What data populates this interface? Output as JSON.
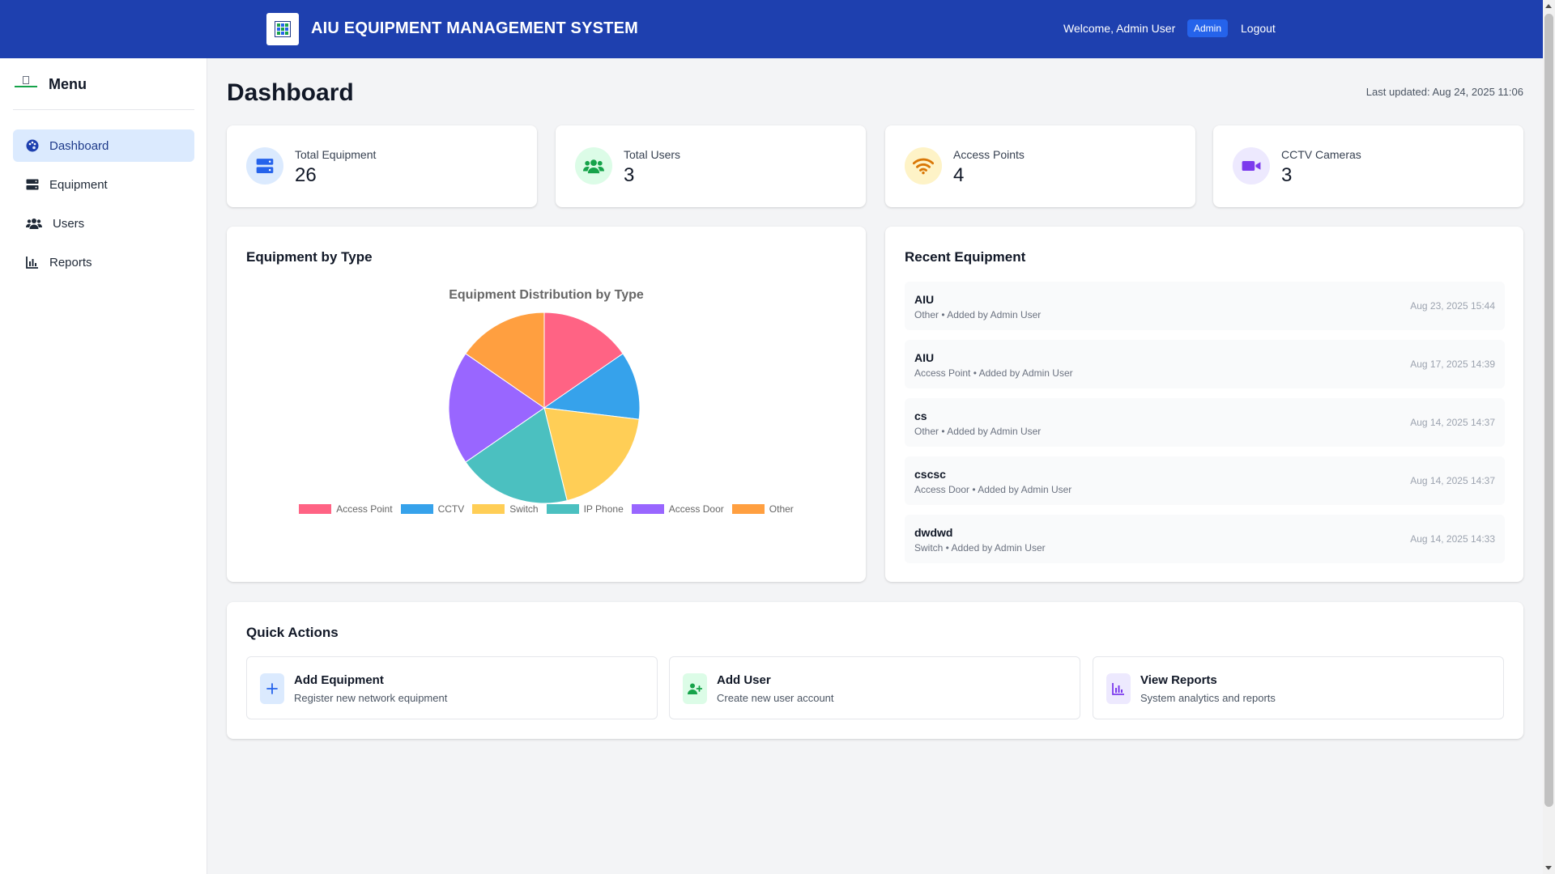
{
  "header": {
    "app_title": "AIU EQUIPMENT MANAGEMENT SYSTEM",
    "welcome": "Welcome, Admin User",
    "role_badge": "Admin",
    "logout": "Logout",
    "bg_color": "#1e40af"
  },
  "sidebar": {
    "title": "Menu",
    "items": [
      {
        "label": "Dashboard",
        "icon": "palette-icon",
        "active": true
      },
      {
        "label": "Equipment",
        "icon": "server-icon",
        "active": false
      },
      {
        "label": "Users",
        "icon": "users-icon",
        "active": false
      },
      {
        "label": "Reports",
        "icon": "chart-bar-icon",
        "active": false
      }
    ]
  },
  "main": {
    "title": "Dashboard",
    "last_updated": "Last updated: Aug 24, 2025 11:06"
  },
  "stats": [
    {
      "label": "Total Equipment",
      "value": "26",
      "icon": "server-icon",
      "color": "#2563eb",
      "bg": "#dbeafe"
    },
    {
      "label": "Total Users",
      "value": "3",
      "icon": "users-icon",
      "color": "#16a34a",
      "bg": "#dcfce7"
    },
    {
      "label": "Access Points",
      "value": "4",
      "icon": "wifi-icon",
      "color": "#d97706",
      "bg": "#fef3c7"
    },
    {
      "label": "CCTV Cameras",
      "value": "3",
      "icon": "video-camera-icon",
      "color": "#7c3aed",
      "bg": "#ede9fe"
    }
  ],
  "equipment_by_type": {
    "panel_title": "Equipment by Type"
  },
  "chart_data": {
    "type": "pie",
    "title": "Equipment Distribution by Type",
    "categories": [
      "Access Point",
      "CCTV",
      "Switch",
      "IP Phone",
      "Access Door",
      "Other"
    ],
    "values": [
      4,
      3,
      5,
      5,
      5,
      4
    ],
    "colors": [
      "#ff6384",
      "#36a2eb",
      "#ffce56",
      "#4bc0c0",
      "#9966ff",
      "#ff9f40"
    ],
    "legend": "bottom"
  },
  "recent": {
    "panel_title": "Recent Equipment",
    "items": [
      {
        "name": "AIU",
        "meta": "Other • Added by Admin User",
        "date": "Aug 23, 2025 15:44"
      },
      {
        "name": "AIU",
        "meta": "Access Point • Added by Admin User",
        "date": "Aug 17, 2025 14:39"
      },
      {
        "name": "cs",
        "meta": "Other • Added by Admin User",
        "date": "Aug 14, 2025 14:37"
      },
      {
        "name": "cscsc",
        "meta": "Access Door • Added by Admin User",
        "date": "Aug 14, 2025 14:37"
      },
      {
        "name": "dwdwd",
        "meta": "Switch • Added by Admin User",
        "date": "Aug 14, 2025 14:33"
      }
    ]
  },
  "quick_actions": {
    "panel_title": "Quick Actions",
    "items": [
      {
        "title": "Add Equipment",
        "desc": "Register new network equipment",
        "icon": "plus-icon",
        "color": "#2563eb",
        "bg": "#dbeafe"
      },
      {
        "title": "Add User",
        "desc": "Create new user account",
        "icon": "user-plus-icon",
        "color": "#16a34a",
        "bg": "#dcfce7"
      },
      {
        "title": "View Reports",
        "desc": "System analytics and reports",
        "icon": "chart-bar-icon",
        "color": "#7c3aed",
        "bg": "#ede9fe"
      }
    ]
  }
}
